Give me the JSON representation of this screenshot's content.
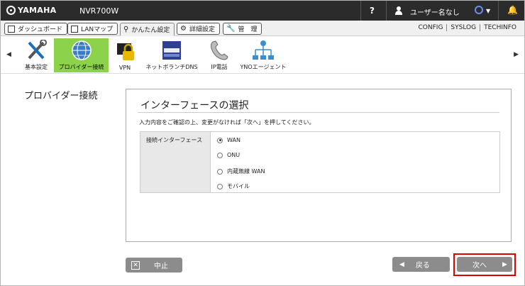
{
  "header": {
    "brand": "YAMAHA",
    "model": "NVR700W",
    "help_label": "?",
    "user_name": "ユーザー名なし",
    "user_icon": "user-icon",
    "bell_icon": "bell-icon"
  },
  "tabs": [
    {
      "label": "ダッシュボード",
      "icon": "dashboard-icon"
    },
    {
      "label": "LANマップ",
      "icon": "lan-map-icon"
    },
    {
      "label": "かんたん設定",
      "icon": "wand-icon",
      "active": true
    },
    {
      "label": "詳細設定",
      "icon": "gear-icon"
    },
    {
      "label": "管　理",
      "icon": "wrench-icon"
    }
  ],
  "links": [
    "CONFIG",
    "SYSLOG",
    "TECHINFO"
  ],
  "toolbar": {
    "items": [
      {
        "label": "基本設定",
        "icon": "tools-icon"
      },
      {
        "label": "プロバイダー接続",
        "icon": "globe-icon",
        "active": true
      },
      {
        "label": "VPN",
        "icon": "lock-icon"
      },
      {
        "label": "ネットボランチDNS",
        "icon": "dns-icon"
      },
      {
        "label": "IP電話",
        "icon": "phone-icon"
      },
      {
        "label": "YNOエージェント",
        "icon": "network-icon"
      }
    ]
  },
  "page": {
    "section_title": "プロバイダー接続",
    "panel_title": "インターフェースの選択",
    "description": "入力内容をご確認の上、変更がなければ「次へ」を押してください。",
    "field_label": "接続インターフェース",
    "options": [
      {
        "label": "WAN",
        "selected": true
      },
      {
        "label": "ONU",
        "selected": false
      },
      {
        "label": "内蔵無線 WAN",
        "selected": false
      },
      {
        "label": "モバイル",
        "selected": false
      }
    ]
  },
  "buttons": {
    "cancel": "中止",
    "back": "戻る",
    "next": "次へ"
  },
  "colors": {
    "active_green": "#8cd24a",
    "topbar": "#2b2b2b",
    "highlight": "#e00000"
  }
}
